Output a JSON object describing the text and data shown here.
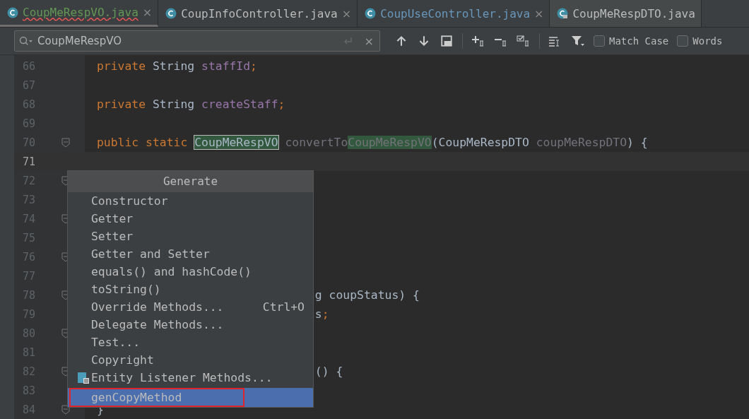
{
  "tabs": [
    {
      "label": "CoupMeRespVO.java",
      "selected": true,
      "color": "#629755",
      "error": true,
      "locked": false,
      "close": "×"
    },
    {
      "label": "CoupInfoController.java",
      "selected": false,
      "color": "#bbbbbb",
      "error": false,
      "locked": false,
      "close": "×"
    },
    {
      "label": "CoupUseController.java",
      "selected": false,
      "color": "#6897bb",
      "error": false,
      "locked": false,
      "close": "×"
    },
    {
      "label": "CoupMeRespDTO.java",
      "selected": false,
      "color": "#bbbbbb",
      "error": false,
      "locked": true
    }
  ],
  "search": {
    "value": "CoupMeRespVO",
    "close": "×"
  },
  "options": [
    {
      "label": "Match Case",
      "checked": false
    },
    {
      "label": "Words",
      "checked": false
    }
  ],
  "lines": [
    {
      "number": "66",
      "current": false,
      "fold": false,
      "tokens": [
        {
          "kind": "keyword",
          "text": "private "
        },
        {
          "kind": "plain",
          "text": "String "
        },
        {
          "kind": "field",
          "text": "staffId"
        },
        {
          "kind": "keyword",
          "text": ";"
        }
      ]
    },
    {
      "number": "67",
      "current": false,
      "fold": false
    },
    {
      "number": "68",
      "current": false,
      "fold": false,
      "tokens": [
        {
          "kind": "keyword",
          "text": "private "
        },
        {
          "kind": "plain",
          "text": "String "
        },
        {
          "kind": "field",
          "text": "createStaff"
        },
        {
          "kind": "keyword",
          "text": ";"
        }
      ]
    },
    {
      "number": "69",
      "current": false,
      "fold": false
    },
    {
      "number": "70",
      "current": false,
      "fold": true,
      "tokens": [
        {
          "kind": "keyword",
          "text": "public static "
        },
        {
          "kind": "match-current",
          "text": "CoupMeRespVO"
        },
        {
          "kind": "unused",
          "text": " convertTo"
        },
        {
          "kind": "match",
          "text": "CoupMeRespVO"
        },
        {
          "kind": "plain",
          "text": "(CoupMeRespDTO "
        },
        {
          "kind": "unused",
          "text": "coupMeRespDTO"
        },
        {
          "kind": "plain",
          "text": ") {"
        }
      ]
    },
    {
      "number": "71",
      "current": true,
      "fold": false
    },
    {
      "number": "72",
      "current": false,
      "fold": true
    },
    {
      "number": "73",
      "current": false,
      "fold": false
    },
    {
      "number": "74",
      "current": false,
      "fold": true
    },
    {
      "number": "75",
      "current": false,
      "fold": false
    },
    {
      "number": "76",
      "current": false,
      "fold": true
    },
    {
      "number": "77",
      "current": false,
      "fold": false
    },
    {
      "number": "78",
      "current": false,
      "fold": true,
      "tokens": [
        {
          "kind": "behind",
          "text": "g coupStatus) {"
        }
      ]
    },
    {
      "number": "79",
      "current": false,
      "fold": false,
      "tokens": [
        {
          "kind": "behind",
          "text": "s"
        },
        {
          "kind": "keyword",
          "text": ";"
        }
      ]
    },
    {
      "number": "80",
      "current": false,
      "fold": true
    },
    {
      "number": "81",
      "current": false,
      "fold": false
    },
    {
      "number": "82",
      "current": false,
      "fold": true,
      "tokens": [
        {
          "kind": "behind",
          "text": "() {"
        }
      ]
    },
    {
      "number": "83",
      "current": false,
      "fold": false
    },
    {
      "number": "84",
      "current": false,
      "fold": true,
      "tokens": [
        {
          "kind": "plain",
          "text": "}"
        }
      ]
    }
  ],
  "popup": {
    "title": "Generate",
    "items": [
      {
        "kind": "item",
        "label": "Constructor",
        "selected": false
      },
      {
        "kind": "item",
        "label": "Getter",
        "selected": false
      },
      {
        "kind": "item",
        "label": "Setter",
        "selected": false
      },
      {
        "kind": "item",
        "label": "Getter and Setter",
        "selected": false
      },
      {
        "kind": "item",
        "label": "equals() and hashCode()",
        "selected": false
      },
      {
        "kind": "item",
        "label": "toString()",
        "selected": false
      },
      {
        "kind": "item",
        "label": "Override Methods...",
        "shortcut": "Ctrl+O",
        "selected": false
      },
      {
        "kind": "item",
        "label": "Delegate Methods...",
        "selected": false
      },
      {
        "kind": "item",
        "label": "Test...",
        "selected": false
      },
      {
        "kind": "item",
        "label": "Copyright",
        "selected": false
      },
      {
        "kind": "icon-item",
        "label": "Entity Listener Methods...",
        "selected": false
      },
      {
        "kind": "item",
        "label": "genCopyMethod",
        "selected": true,
        "outlined": true
      }
    ]
  }
}
